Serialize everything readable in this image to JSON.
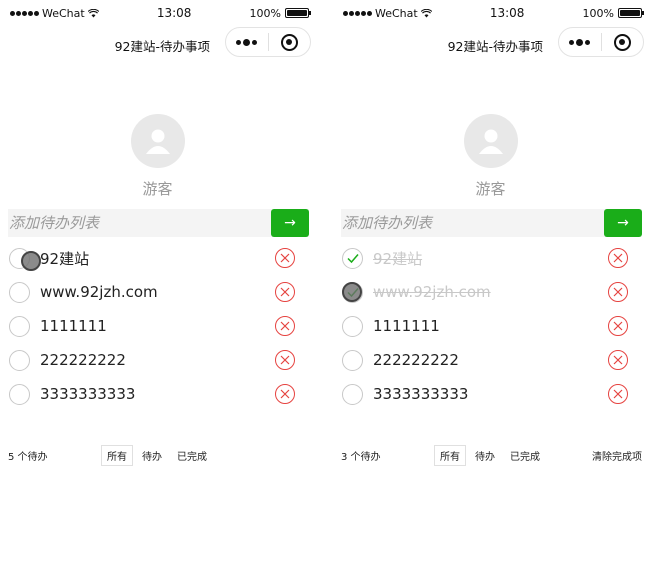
{
  "status_bar": {
    "carrier": "WeChat",
    "time": "13:08",
    "battery": "100%"
  },
  "nav": {
    "title": "92建站-待办事项"
  },
  "user": {
    "name": "游客"
  },
  "input": {
    "placeholder": "添加待办列表",
    "submit_label": "→"
  },
  "screens": [
    {
      "todos": [
        {
          "text": "92建站",
          "done": false
        },
        {
          "text": "www.92jzh.com",
          "done": false
        },
        {
          "text": "1111111",
          "done": false
        },
        {
          "text": "222222222",
          "done": false
        },
        {
          "text": "3333333333",
          "done": false
        }
      ],
      "footer": {
        "count": "5 个待办",
        "filters": [
          "所有",
          "待办",
          "已完成"
        ],
        "active_filter": "所有",
        "clear": ""
      }
    },
    {
      "todos": [
        {
          "text": "92建站",
          "done": true
        },
        {
          "text": "www.92jzh.com",
          "done": true
        },
        {
          "text": "1111111",
          "done": false
        },
        {
          "text": "222222222",
          "done": false
        },
        {
          "text": "3333333333",
          "done": false
        }
      ],
      "footer": {
        "count": "3 个待办",
        "filters": [
          "所有",
          "待办",
          "已完成"
        ],
        "active_filter": "所有",
        "clear": "清除完成项"
      }
    }
  ],
  "icons": {
    "add": "arrow-right-icon",
    "remove": "close-circle-icon",
    "check": "check-icon",
    "avatar": "user-avatar-icon",
    "capsule_more": "more-dots-icon",
    "capsule_close": "target-icon"
  },
  "colors": {
    "accent": "#1aad19",
    "danger": "#e64340",
    "muted": "#c8c8c8"
  }
}
